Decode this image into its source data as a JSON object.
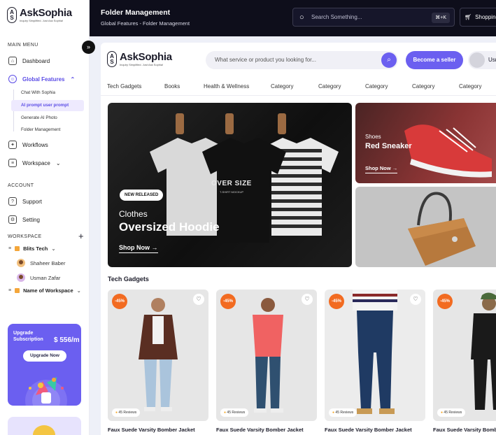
{
  "colors": {
    "accent": "#6b5ff0",
    "topbar": "#0e0e1b",
    "discount": "#f26b21"
  },
  "sidebar": {
    "logo": {
      "name": "AskSophia",
      "tagline": "Inquiry Simplified. Just Ask Sophia!",
      "mark_top": "A",
      "mark_bottom": "S"
    },
    "main_menu_label": "MAIN MENU",
    "items": [
      {
        "label": "Dashboard",
        "icon": "home-icon"
      },
      {
        "label": "Global Features",
        "icon": "user-icon"
      }
    ],
    "global_features_sub": [
      "Chat With Sophia",
      "AI prompt user prompt",
      "Generate AI Photo",
      "Folder Management"
    ],
    "workflows": "Workflows",
    "workspace": "Workspace",
    "account_label": "ACCOUNT",
    "support": "Support",
    "setting": "Setting",
    "workspace_label": "WORKSPACE",
    "workspaces": [
      {
        "name": "Blits Tech",
        "members": [
          "Shaheer Baber",
          "Usman Zafar"
        ]
      },
      {
        "name": "Name of Workspace",
        "members": []
      }
    ],
    "upgrade": {
      "title": "Upgrade Subscription",
      "price": "$ 556/m",
      "button": "Upgrade Now"
    }
  },
  "topbar": {
    "title": "Folder Management",
    "breadcrumb": "Global Features - Folder Management",
    "search_placeholder": "Search Something...",
    "shortcut": "⌘+K",
    "shopping": "Shopping"
  },
  "store": {
    "logo": {
      "name": "AskSophia",
      "tagline": "Inquiry Simplified. Just Ask Sophia!",
      "mark_top": "A",
      "mark_bottom": "S"
    },
    "search_placeholder": "What service or product you looking for...",
    "seller_button": "Become a seller",
    "user_name": "Usman",
    "categories": [
      "Tech Gadgets",
      "Books",
      "Health & Wellness",
      "Category",
      "Category",
      "Category",
      "Category",
      "Category"
    ],
    "hero": {
      "badge": "NEW RELEASED",
      "kicker": "Clothes",
      "title": "Oversized Hoodie",
      "cta": "Shop Now",
      "shirt_text": "OVER SIZE",
      "shirt_sub": "T-SHIRT MOCKUP"
    },
    "side_banner": {
      "kicker": "Shoes",
      "title": "Red Sneaker",
      "cta": "Shop Now"
    },
    "section_title": "Tech Gadgets",
    "products": [
      {
        "discount": "-45%",
        "reviews": "45 Reviews",
        "title": "Faux Suede Varsity Bomber Jacket"
      },
      {
        "discount": "-45%",
        "reviews": "45 Reviews",
        "title": "Faux Suede Varsity Bomber Jacket"
      },
      {
        "discount": "-45%",
        "reviews": "45 Reviews",
        "title": "Faux Suede Varsity Bomber Jacket"
      },
      {
        "discount": "-45%",
        "reviews": "45 Reviews",
        "title": "Faux Suede Varsity Bomber Jacket"
      }
    ]
  }
}
